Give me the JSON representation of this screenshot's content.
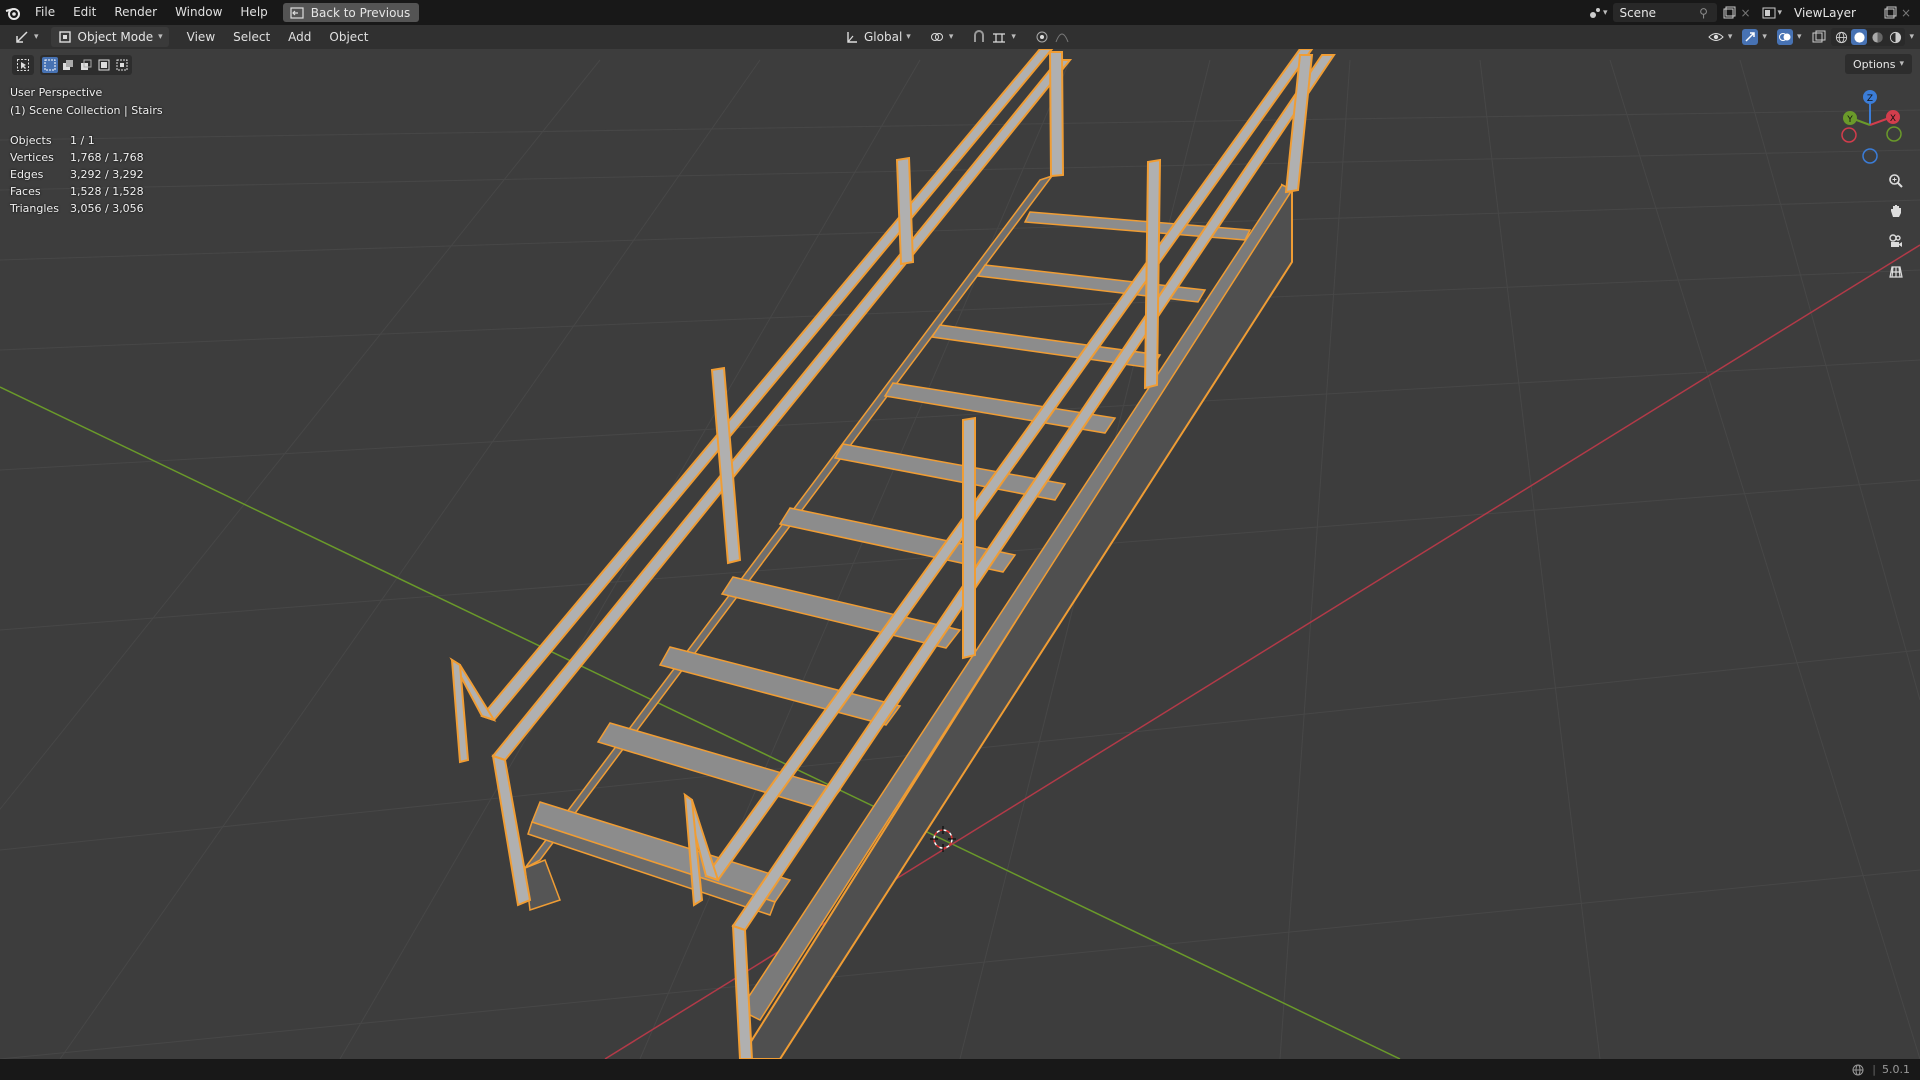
{
  "menu": {
    "items": [
      "File",
      "Edit",
      "Render",
      "Window",
      "Help"
    ],
    "back_button": "Back to Previous"
  },
  "top_right": {
    "scene": "Scene",
    "view_layer": "ViewLayer"
  },
  "header": {
    "mode": "Object Mode",
    "menus": [
      "View",
      "Select",
      "Add",
      "Object"
    ],
    "transform_orientation": "Global",
    "options_label": "Options"
  },
  "viewport": {
    "view_name": "User Perspective",
    "collection": "(1) Scene Collection | Stairs",
    "stats": [
      {
        "label": "Objects",
        "value": "1 / 1"
      },
      {
        "label": "Vertices",
        "value": "1,768 / 1,768"
      },
      {
        "label": "Edges",
        "value": "3,292 / 3,292"
      },
      {
        "label": "Faces",
        "value": "1,528 / 1,528"
      },
      {
        "label": "Triangles",
        "value": "3,056 / 3,056"
      }
    ],
    "gizmo": {
      "z": "Z",
      "x": "X",
      "y": "Y"
    }
  },
  "status": {
    "version": "5.0.1"
  },
  "colors": {
    "selection_outline": "#f09d34",
    "rail": "#b0b0b0",
    "tread": "#8c8c8c",
    "stringer": "#5a5a5a",
    "x_axis": "#b23a48",
    "y_axis": "#6a9a2a"
  },
  "icons": [
    "blender-logo-icon",
    "back-icon",
    "scene-icon",
    "pin-icon",
    "new-scene-icon",
    "close-icon",
    "viewlayer-icon",
    "editor-type-icon",
    "object-mode-icon",
    "orientation-icon",
    "pivot-icon",
    "snap-icon",
    "snap-increment-icon",
    "proportional-icon",
    "falloff-icon",
    "visibility-icon",
    "gizmo-icon",
    "overlay-icon",
    "xray-icon",
    "wireframe-shading-icon",
    "solid-shading-icon",
    "material-shading-icon",
    "rendered-shading-icon",
    "select-tool-icon",
    "zoom-icon",
    "hand-pan-icon",
    "camera-icon",
    "grid-ortho-icon",
    "cursor-3d-icon",
    "globe-icon"
  ]
}
